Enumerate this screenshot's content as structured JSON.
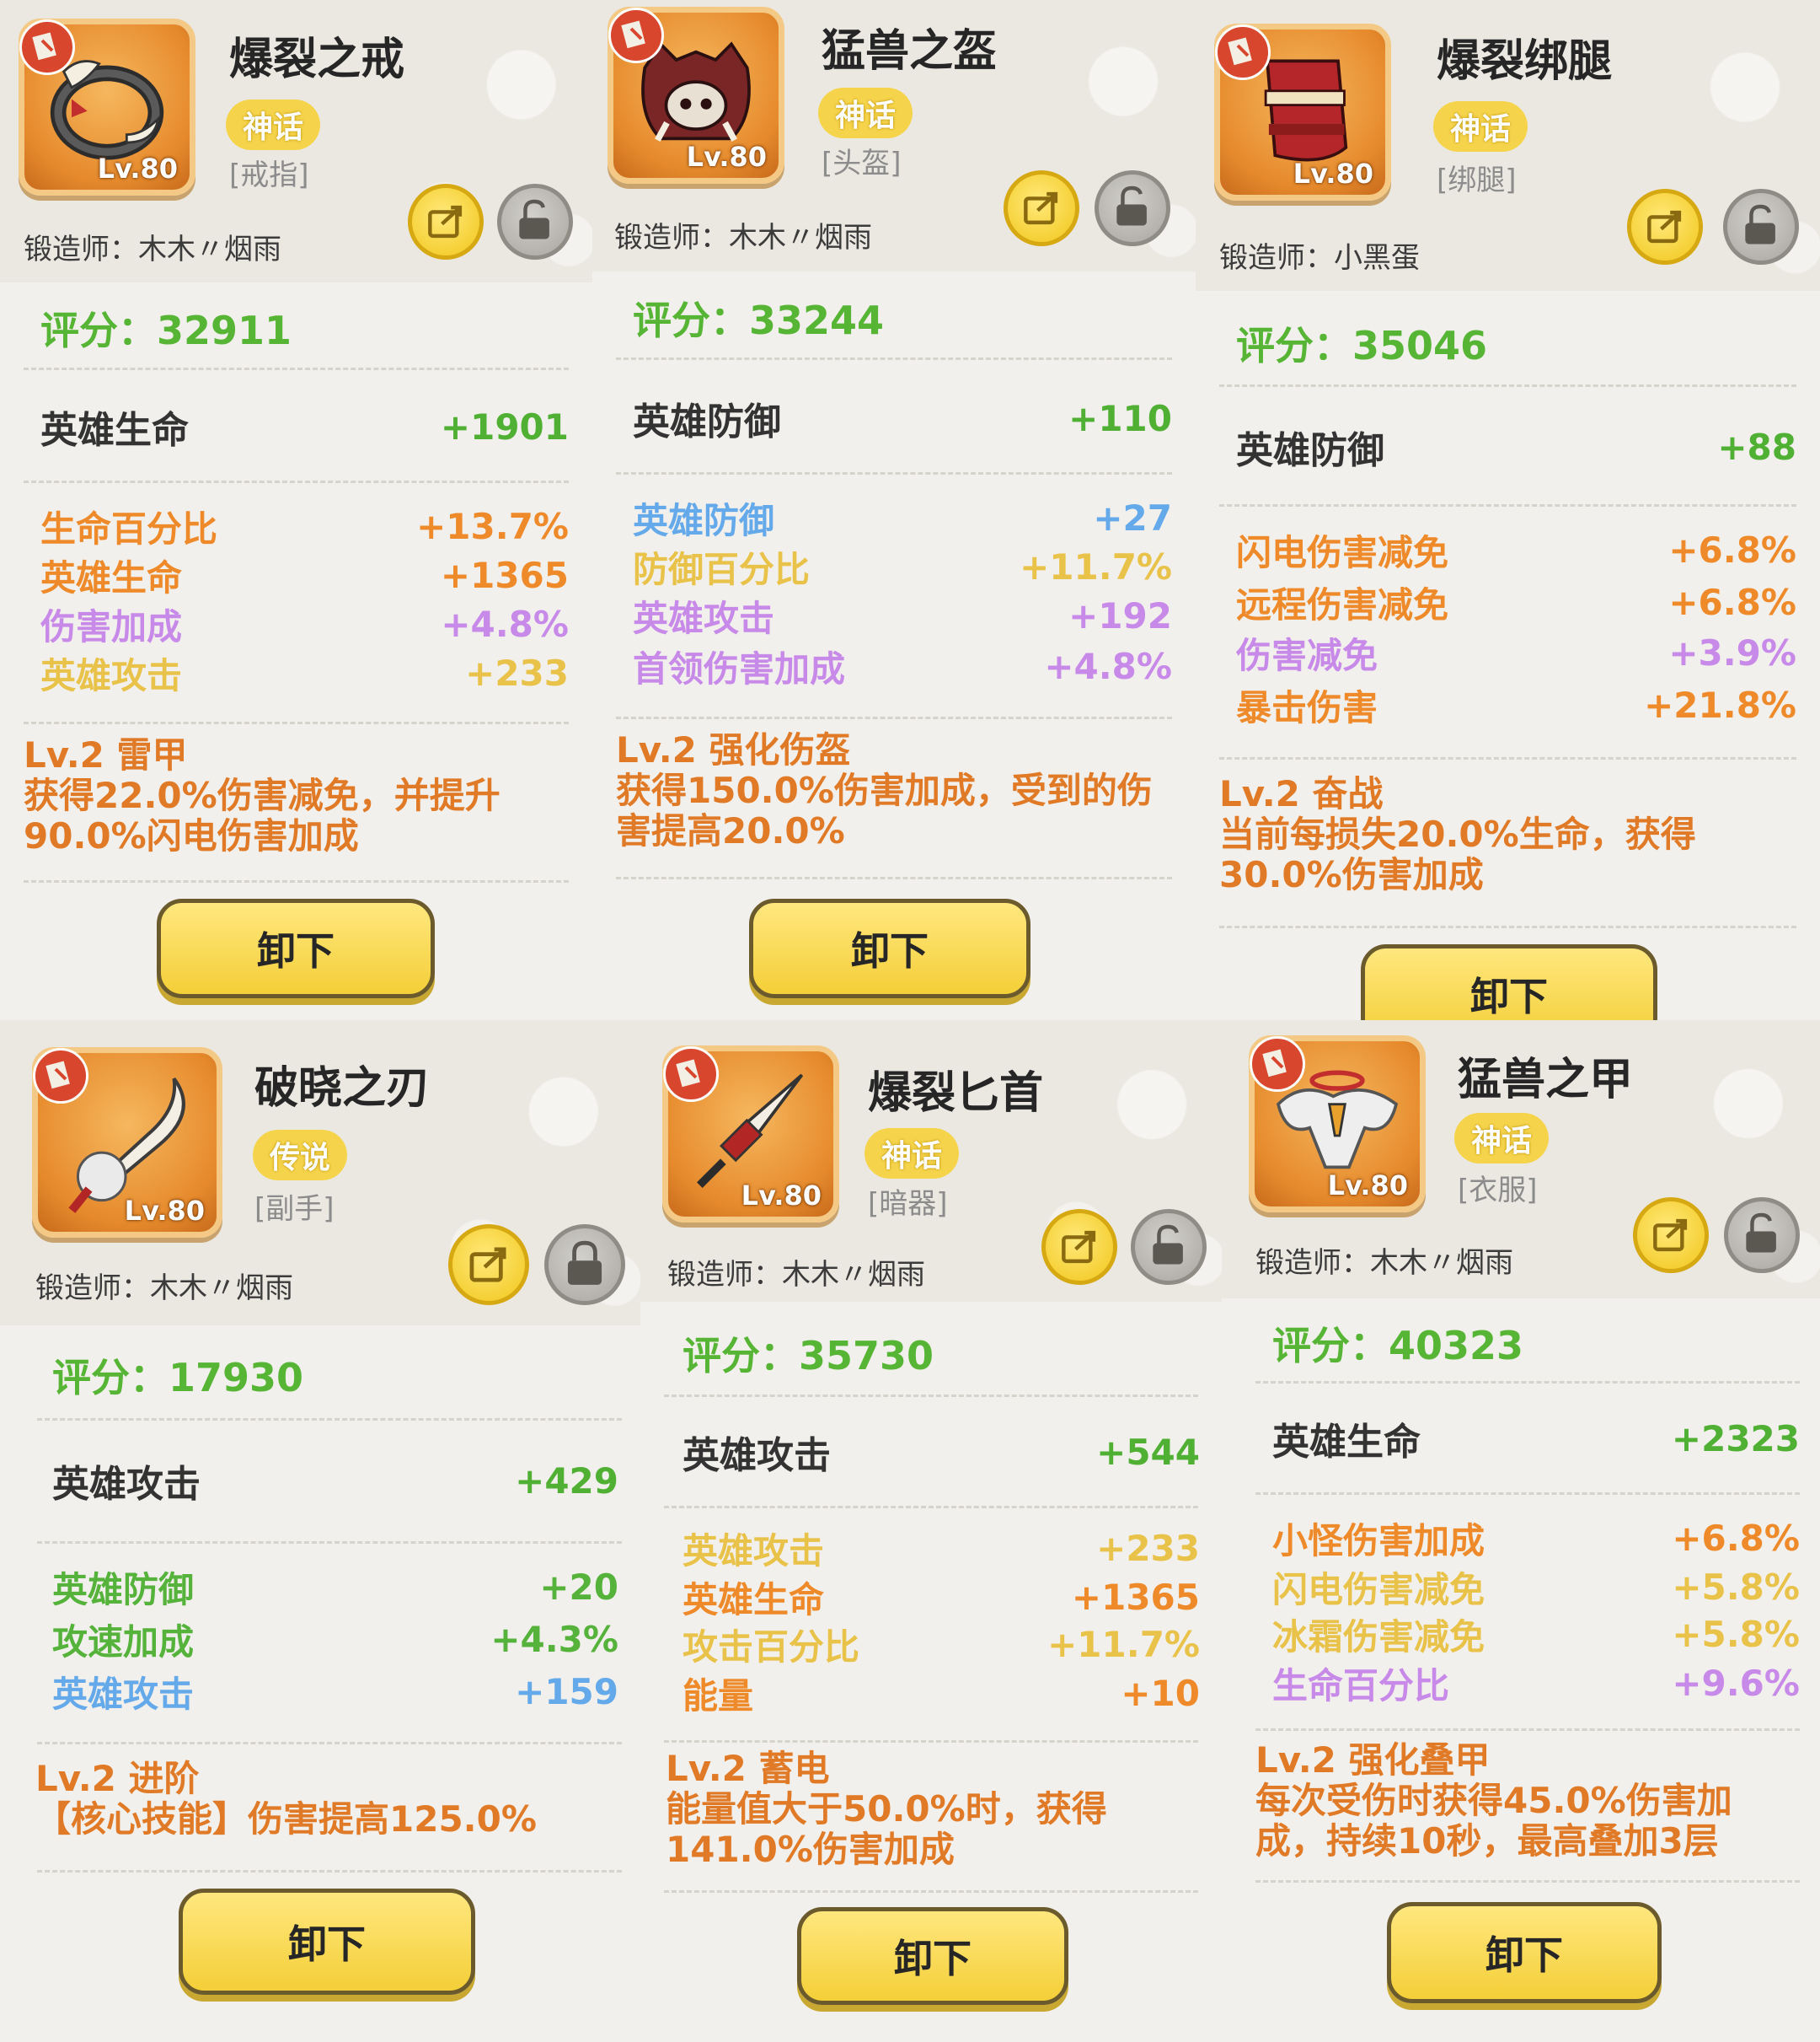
{
  "cards": [
    {
      "name": "爆裂之戒",
      "rarity": "神话",
      "slot": "[戒指]",
      "level": "Lv.80",
      "smith_label": "锻造师：",
      "smith": "木木〃烟雨",
      "score_label": "评分：",
      "score": "32911",
      "base_stat": {
        "label": "英雄生命",
        "value": "+1901"
      },
      "affixes": [
        {
          "label": "生命百分比",
          "value": "+13.7%",
          "color": "orange"
        },
        {
          "label": "英雄生命",
          "value": "+1365",
          "color": "orange"
        },
        {
          "label": "伤害加成",
          "value": "+4.8%",
          "color": "purple"
        },
        {
          "label": "英雄攻击",
          "value": "+233",
          "color": "yellow"
        }
      ],
      "skill_title": "Lv.2 雷甲",
      "skill_desc": "获得22.0%伤害减免，并提升90.0%闪电伤害加成",
      "button": "卸下",
      "icon": "ring-icon"
    },
    {
      "name": "猛兽之盔",
      "rarity": "神话",
      "slot": "[头盔]",
      "level": "Lv.80",
      "smith_label": "锻造师：",
      "smith": "木木〃烟雨",
      "score_label": "评分：",
      "score": "33244",
      "base_stat": {
        "label": "英雄防御",
        "value": "+110"
      },
      "affixes": [
        {
          "label": "英雄防御",
          "value": "+27",
          "color": "blue"
        },
        {
          "label": "防御百分比",
          "value": "+11.7%",
          "color": "yellow"
        },
        {
          "label": "英雄攻击",
          "value": "+192",
          "color": "purple"
        },
        {
          "label": "首领伤害加成",
          "value": "+4.8%",
          "color": "purple"
        }
      ],
      "skill_title": "Lv.2 强化伤盔",
      "skill_desc": "获得150.0%伤害加成，受到的伤害提高20.0%",
      "button": "卸下",
      "icon": "boar-helmet-icon"
    },
    {
      "name": "爆裂绑腿",
      "rarity": "神话",
      "slot": "[绑腿]",
      "level": "Lv.80",
      "smith_label": "锻造师：",
      "smith": "小黑蛋",
      "score_label": "评分：",
      "score": "35046",
      "base_stat": {
        "label": "英雄防御",
        "value": "+88"
      },
      "affixes": [
        {
          "label": "闪电伤害减免",
          "value": "+6.8%",
          "color": "orange"
        },
        {
          "label": "远程伤害减免",
          "value": "+6.8%",
          "color": "orange"
        },
        {
          "label": "伤害减免",
          "value": "+3.9%",
          "color": "purple"
        },
        {
          "label": "暴击伤害",
          "value": "+21.8%",
          "color": "orange"
        }
      ],
      "skill_title": "Lv.2 奋战",
      "skill_desc": "当前每损失20.0%生命，获得30.0%伤害加成",
      "button": "卸下",
      "icon": "leggings-icon"
    },
    {
      "name": "破晓之刃",
      "rarity": "传说",
      "slot": "[副手]",
      "level": "Lv.80",
      "smith_label": "锻造师：",
      "smith": "木木〃烟雨",
      "score_label": "评分：",
      "score": "17930",
      "base_stat": {
        "label": "英雄攻击",
        "value": "+429"
      },
      "affixes": [
        {
          "label": "英雄防御",
          "value": "+20",
          "color": "green"
        },
        {
          "label": "攻速加成",
          "value": "+4.3%",
          "color": "green"
        },
        {
          "label": "英雄攻击",
          "value": "+159",
          "color": "blue"
        }
      ],
      "skill_title": "Lv.2 进阶",
      "skill_desc": "【核心技能】伤害提高125.0%",
      "button": "卸下",
      "icon": "blade-icon"
    },
    {
      "name": "爆裂匕首",
      "rarity": "神话",
      "slot": "[暗器]",
      "level": "Lv.80",
      "smith_label": "锻造师：",
      "smith": "木木〃烟雨",
      "score_label": "评分：",
      "score": "35730",
      "base_stat": {
        "label": "英雄攻击",
        "value": "+544"
      },
      "affixes": [
        {
          "label": "英雄攻击",
          "value": "+233",
          "color": "yellow"
        },
        {
          "label": "英雄生命",
          "value": "+1365",
          "color": "orange"
        },
        {
          "label": "攻击百分比",
          "value": "+11.7%",
          "color": "yellow"
        },
        {
          "label": "能量",
          "value": "+10",
          "color": "orange"
        }
      ],
      "skill_title": "Lv.2 蓄电",
      "skill_desc": "能量值大于50.0%时，获得141.0%伤害加成",
      "button": "卸下",
      "icon": "dagger-icon"
    },
    {
      "name": "猛兽之甲",
      "rarity": "神话",
      "slot": "[衣服]",
      "level": "Lv.80",
      "smith_label": "锻造师：",
      "smith": "木木〃烟雨",
      "score_label": "评分：",
      "score": "40323",
      "base_stat": {
        "label": "英雄生命",
        "value": "+2323"
      },
      "affixes": [
        {
          "label": "小怪伤害加成",
          "value": "+6.8%",
          "color": "orange"
        },
        {
          "label": "闪电伤害减免",
          "value": "+5.8%",
          "color": "yellow"
        },
        {
          "label": "冰霜伤害减免",
          "value": "+5.8%",
          "color": "yellow"
        },
        {
          "label": "生命百分比",
          "value": "+9.6%",
          "color": "purple"
        }
      ],
      "skill_title": "Lv.2 强化叠甲",
      "skill_desc": "每次受伤时获得45.0%伤害加成，持续10秒，最高叠加3层",
      "button": "卸下",
      "icon": "feather-armor-icon"
    }
  ]
}
